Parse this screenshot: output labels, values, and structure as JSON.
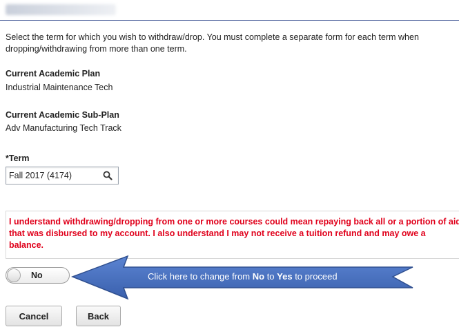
{
  "instructions": "Select the term for which you wish to withdraw/drop. You must complete a separate form for each term when dropping/withdrawing from more than one term.",
  "academic_plan": {
    "label": "Current Academic Plan",
    "value": "Industrial Maintenance Tech"
  },
  "academic_subplan": {
    "label": "Current Academic Sub-Plan",
    "value": "Adv Manufacturing Tech Track"
  },
  "term": {
    "label": "*Term",
    "value": "Fall 2017 (4174)",
    "icon": "search-icon"
  },
  "warning": "I understand withdrawing/dropping from one or more courses could mean repaying back all or a portion of aid that was disbursed to my account. I also understand I may not receive a tuition refund and may owe a balance.",
  "toggle": {
    "value": "No"
  },
  "callout": {
    "prefix": "Click here to change from ",
    "from": "No",
    "middle": " to ",
    "to": "Yes",
    "suffix": " to proceed",
    "color": "#3f68b8"
  },
  "buttons": {
    "cancel": "Cancel",
    "back": "Back"
  },
  "colors": {
    "warning_text": "#e0001b",
    "header_rule": "#4a5e9a"
  }
}
